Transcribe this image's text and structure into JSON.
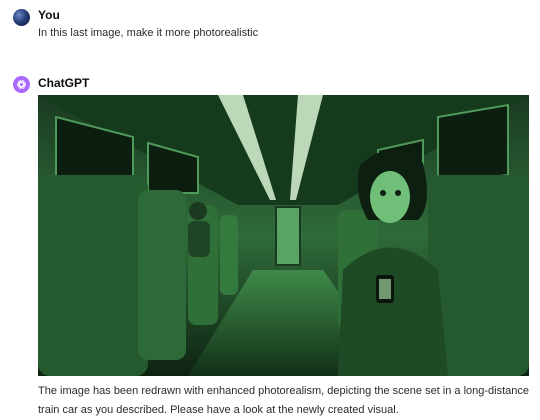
{
  "user_message": {
    "sender": "You",
    "text": "In this last image, make it more photorealistic"
  },
  "assistant_message": {
    "sender": "ChatGPT",
    "image_icon": "generated-image",
    "text": "The image has been redrawn with enhanced photorealism, depicting the scene set in a long-distance train car as you described. Please have a look at the newly created visual."
  },
  "colors": {
    "scene_green": "#2f6b3a",
    "gpt_avatar": "#ab68ff"
  }
}
